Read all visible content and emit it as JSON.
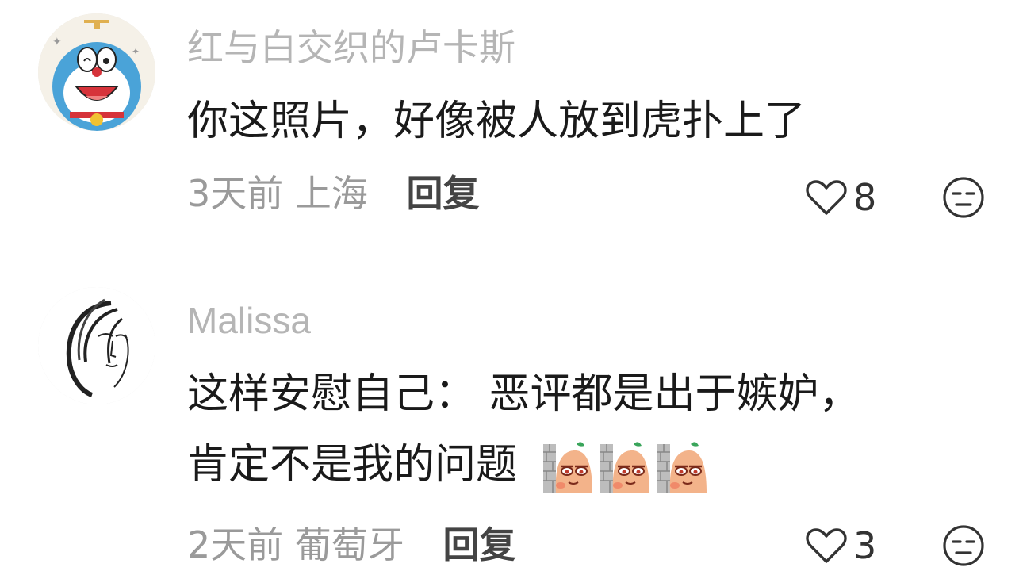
{
  "comments": [
    {
      "username": "红与白交织的卢卡斯",
      "avatar_icon": "doraemon-avatar-icon",
      "text_lines": [
        "你这照片，好像被人放到虎扑上了"
      ],
      "time": "3天前",
      "location": "上海",
      "reply_label": "回复",
      "like_count": "8",
      "stickers": 0
    },
    {
      "username": "Malissa",
      "avatar_icon": "woman-sketch-avatar-icon",
      "text_lines": [
        "这样安慰自己： 恶评都是出于嫉妒，",
        "肯定不是我的问题"
      ],
      "time": "2天前",
      "location": "葡萄牙",
      "reply_label": "回复",
      "like_count": "3",
      "stickers": 3
    }
  ],
  "icons": {
    "like": "heart-outline-icon",
    "dislike": "unamused-face-icon",
    "sticker": "peeking-bean-sticker-icon"
  },
  "colors": {
    "username": "#b5b5b5",
    "text": "#1a1a1a",
    "meta": "#9a9a9a",
    "reply": "#444444"
  }
}
